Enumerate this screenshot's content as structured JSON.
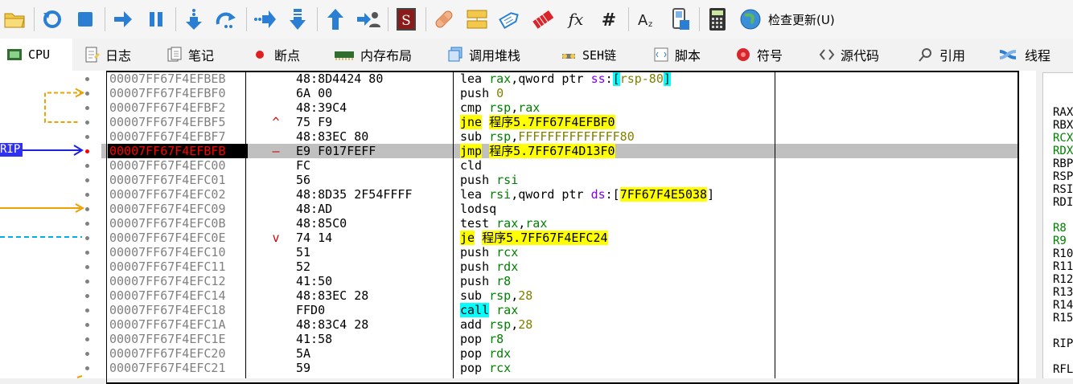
{
  "toolbar": {
    "icons": [
      "open-folder",
      "restart",
      "stop",
      "run",
      "pause",
      "step-into",
      "step-over",
      "trace-into",
      "trace-over",
      "execute-till-return",
      "run-to-user-code",
      "scylla",
      "patch",
      "comment",
      "label",
      "bookmark",
      "function",
      "hash",
      "font-size",
      "calculator-script",
      "calculator",
      "check-update"
    ],
    "update_label": "检查更新(U)"
  },
  "tabs": [
    {
      "id": "cpu",
      "label": "CPU",
      "icon": "cpu-icon",
      "active": true
    },
    {
      "id": "log",
      "label": "日志",
      "icon": "log-icon"
    },
    {
      "id": "notes",
      "label": "笔记",
      "icon": "notes-icon"
    },
    {
      "id": "breakpoints",
      "label": "断点",
      "icon": "breakpoint-icon"
    },
    {
      "id": "memory",
      "label": "内存布局",
      "icon": "memory-icon"
    },
    {
      "id": "callstack",
      "label": "调用堆栈",
      "icon": "callstack-icon"
    },
    {
      "id": "seh",
      "label": "SEH链",
      "icon": "seh-icon"
    },
    {
      "id": "script",
      "label": "脚本",
      "icon": "script-icon"
    },
    {
      "id": "symbols",
      "label": "符号",
      "icon": "symbols-icon"
    },
    {
      "id": "source",
      "label": "源代码",
      "icon": "source-icon"
    },
    {
      "id": "references",
      "label": "引用",
      "icon": "references-icon"
    },
    {
      "id": "threads",
      "label": "线程",
      "icon": "threads-icon"
    }
  ],
  "rip_label": "RIP",
  "disasm": [
    {
      "addr": "00007FF67F4EFBEB",
      "bytes": "48:8D4424 80",
      "mark": "",
      "instr": [
        {
          "t": "lea ",
          "c": "mn"
        },
        {
          "t": "rax",
          "c": "c-reg"
        },
        {
          "t": ",qword ptr ",
          "c": "mn"
        },
        {
          "t": "ss",
          "c": "c-seg"
        },
        {
          "t": ":",
          "c": "mn"
        },
        {
          "t": "[",
          "c": "c-cy"
        },
        {
          "t": "rsp-80",
          "c": "c-num"
        },
        {
          "t": "]",
          "c": "c-cy"
        }
      ]
    },
    {
      "addr": "00007FF67F4EFBF0",
      "bytes": "6A 00",
      "mark": "",
      "instr": [
        {
          "t": "push ",
          "c": "mn"
        },
        {
          "t": "0",
          "c": "c-num"
        }
      ]
    },
    {
      "addr": "00007FF67F4EFBF2",
      "bytes": "48:39C4",
      "mark": "",
      "instr": [
        {
          "t": "cmp ",
          "c": "mn"
        },
        {
          "t": "rsp",
          "c": "c-reg"
        },
        {
          "t": ",",
          "c": "mn"
        },
        {
          "t": "rax",
          "c": "c-reg"
        }
      ]
    },
    {
      "addr": "00007FF67F4EFBF5",
      "bytes": "75 F9",
      "mark": "^",
      "instr": [
        {
          "t": "jne",
          "c": "c-hl"
        },
        {
          "t": " ",
          "c": "mn"
        },
        {
          "t": "程序5.7FF67F4EFBF0",
          "c": "c-hl"
        }
      ]
    },
    {
      "addr": "00007FF67F4EFBF7",
      "bytes": "48:83EC 80",
      "mark": "",
      "instr": [
        {
          "t": "sub ",
          "c": "mn"
        },
        {
          "t": "rsp",
          "c": "c-reg"
        },
        {
          "t": ",",
          "c": "mn"
        },
        {
          "t": "FFFFFFFFFFFFFF80",
          "c": "c-num"
        }
      ]
    },
    {
      "addr": "00007FF67F4EFBFB",
      "bytes": "E9 F017FEFF",
      "mark": "–",
      "current": true,
      "instr": [
        {
          "t": "jmp",
          "c": "c-hl"
        },
        {
          "t": " ",
          "c": "mn"
        },
        {
          "t": "程序5.7FF67F4D13F0",
          "c": "c-hl"
        }
      ]
    },
    {
      "addr": "00007FF67F4EFC00",
      "bytes": "FC",
      "mark": "",
      "instr": [
        {
          "t": "cld",
          "c": "mn"
        }
      ]
    },
    {
      "addr": "00007FF67F4EFC01",
      "bytes": "56",
      "mark": "",
      "instr": [
        {
          "t": "push ",
          "c": "mn"
        },
        {
          "t": "rsi",
          "c": "c-reg"
        }
      ]
    },
    {
      "addr": "00007FF67F4EFC02",
      "bytes": "48:8D35 2F54FFFF",
      "mark": "",
      "instr": [
        {
          "t": "lea ",
          "c": "mn"
        },
        {
          "t": "rsi",
          "c": "c-reg"
        },
        {
          "t": ",qword ptr ",
          "c": "mn"
        },
        {
          "t": "ds",
          "c": "c-seg"
        },
        {
          "t": ":[",
          "c": "mn"
        },
        {
          "t": "7FF67F4E5038",
          "c": "c-hl"
        },
        {
          "t": "]",
          "c": "mn"
        }
      ]
    },
    {
      "addr": "00007FF67F4EFC09",
      "bytes": "48:AD",
      "mark": "",
      "instr": [
        {
          "t": "lodsq",
          "c": "mn"
        }
      ]
    },
    {
      "addr": "00007FF67F4EFC0B",
      "bytes": "48:85C0",
      "mark": "",
      "instr": [
        {
          "t": "test ",
          "c": "mn"
        },
        {
          "t": "rax",
          "c": "c-reg"
        },
        {
          "t": ",",
          "c": "mn"
        },
        {
          "t": "rax",
          "c": "c-reg"
        }
      ]
    },
    {
      "addr": "00007FF67F4EFC0E",
      "bytes": "74 14",
      "mark": "v",
      "instr": [
        {
          "t": "je",
          "c": "c-hl"
        },
        {
          "t": " ",
          "c": "mn"
        },
        {
          "t": "程序5.7FF67F4EFC24",
          "c": "c-hl"
        }
      ]
    },
    {
      "addr": "00007FF67F4EFC10",
      "bytes": "51",
      "mark": "",
      "instr": [
        {
          "t": "push ",
          "c": "mn"
        },
        {
          "t": "rcx",
          "c": "c-reg"
        }
      ]
    },
    {
      "addr": "00007FF67F4EFC11",
      "bytes": "52",
      "mark": "",
      "instr": [
        {
          "t": "push ",
          "c": "mn"
        },
        {
          "t": "rdx",
          "c": "c-reg"
        }
      ]
    },
    {
      "addr": "00007FF67F4EFC12",
      "bytes": "41:50",
      "mark": "",
      "instr": [
        {
          "t": "push ",
          "c": "mn"
        },
        {
          "t": "r8",
          "c": "c-reg"
        }
      ]
    },
    {
      "addr": "00007FF67F4EFC14",
      "bytes": "48:83EC 28",
      "mark": "",
      "instr": [
        {
          "t": "sub ",
          "c": "mn"
        },
        {
          "t": "rsp",
          "c": "c-reg"
        },
        {
          "t": ",",
          "c": "mn"
        },
        {
          "t": "28",
          "c": "c-num"
        }
      ]
    },
    {
      "addr": "00007FF67F4EFC18",
      "bytes": "FFD0",
      "mark": "",
      "instr": [
        {
          "t": "call",
          "c": "c-cy"
        },
        {
          "t": " ",
          "c": "mn"
        },
        {
          "t": "rax",
          "c": "c-reg"
        }
      ]
    },
    {
      "addr": "00007FF67F4EFC1A",
      "bytes": "48:83C4 28",
      "mark": "",
      "instr": [
        {
          "t": "add ",
          "c": "mn"
        },
        {
          "t": "rsp",
          "c": "c-reg"
        },
        {
          "t": ",",
          "c": "mn"
        },
        {
          "t": "28",
          "c": "c-num"
        }
      ]
    },
    {
      "addr": "00007FF67F4EFC1E",
      "bytes": "41:58",
      "mark": "",
      "instr": [
        {
          "t": "pop ",
          "c": "mn"
        },
        {
          "t": "r8",
          "c": "c-reg"
        }
      ]
    },
    {
      "addr": "00007FF67F4EFC20",
      "bytes": "5A",
      "mark": "",
      "instr": [
        {
          "t": "pop ",
          "c": "mn"
        },
        {
          "t": "rdx",
          "c": "c-reg"
        }
      ]
    },
    {
      "addr": "00007FF67F4EFC21",
      "bytes": "59",
      "mark": "",
      "instr": [
        {
          "t": "pop ",
          "c": "mn"
        },
        {
          "t": "rcx",
          "c": "c-reg"
        }
      ]
    }
  ],
  "registers": [
    {
      "name": "RAX",
      "color": "k"
    },
    {
      "name": "RBX",
      "color": "k"
    },
    {
      "name": "RCX",
      "color": "g"
    },
    {
      "name": "RDX",
      "color": "g"
    },
    {
      "name": "RBP",
      "color": "k"
    },
    {
      "name": "RSP",
      "color": "k"
    },
    {
      "name": "RSI",
      "color": "k"
    },
    {
      "name": "RDI",
      "color": "k"
    },
    {
      "name": "",
      "color": "k"
    },
    {
      "name": "R8",
      "color": "g"
    },
    {
      "name": "R9",
      "color": "g"
    },
    {
      "name": "R10",
      "color": "k"
    },
    {
      "name": "R11",
      "color": "k"
    },
    {
      "name": "R12",
      "color": "k"
    },
    {
      "name": "R13",
      "color": "k"
    },
    {
      "name": "R14",
      "color": "k"
    },
    {
      "name": "R15",
      "color": "k"
    },
    {
      "name": "",
      "color": "k"
    },
    {
      "name": "RIP",
      "color": "k"
    },
    {
      "name": "",
      "color": "k"
    },
    {
      "name": "RFL",
      "color": "k"
    }
  ]
}
